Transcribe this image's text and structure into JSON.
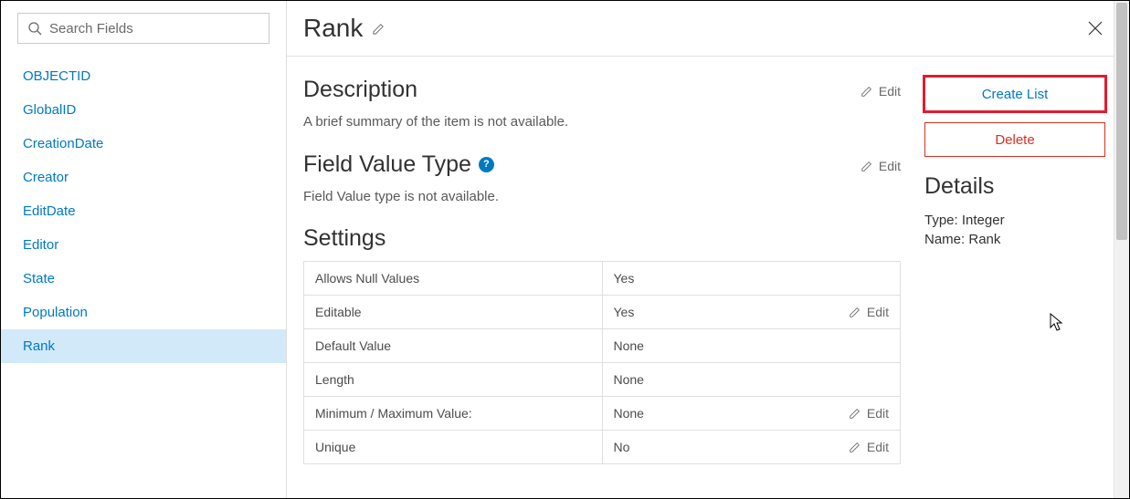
{
  "search": {
    "placeholder": "Search Fields"
  },
  "fields": [
    {
      "label": "OBJECTID",
      "selected": false
    },
    {
      "label": "GlobalID",
      "selected": false
    },
    {
      "label": "CreationDate",
      "selected": false
    },
    {
      "label": "Creator",
      "selected": false
    },
    {
      "label": "EditDate",
      "selected": false
    },
    {
      "label": "Editor",
      "selected": false
    },
    {
      "label": "State",
      "selected": false
    },
    {
      "label": "Population",
      "selected": false
    },
    {
      "label": "Rank",
      "selected": true
    }
  ],
  "main": {
    "title": "Rank",
    "edit_label": "Edit",
    "description": {
      "heading": "Description",
      "body": "A brief summary of the item is not available."
    },
    "fieldValueType": {
      "heading": "Field Value Type",
      "body": "Field Value type is not available.",
      "help_text": "?"
    },
    "settings": {
      "heading": "Settings",
      "rows": [
        {
          "label": "Allows Null Values",
          "value": "Yes",
          "editable": false
        },
        {
          "label": "Editable",
          "value": "Yes",
          "editable": true
        },
        {
          "label": "Default Value",
          "value": "None",
          "editable": false
        },
        {
          "label": "Length",
          "value": "None",
          "editable": false
        },
        {
          "label": "Minimum / Maximum Value:",
          "value": "None",
          "editable": true
        },
        {
          "label": "Unique",
          "value": "No",
          "editable": true
        }
      ]
    }
  },
  "side": {
    "create_list_label": "Create List",
    "delete_label": "Delete",
    "details_heading": "Details",
    "type_label": "Type",
    "type_value": "Integer",
    "name_label": "Name",
    "name_value": "Rank"
  }
}
